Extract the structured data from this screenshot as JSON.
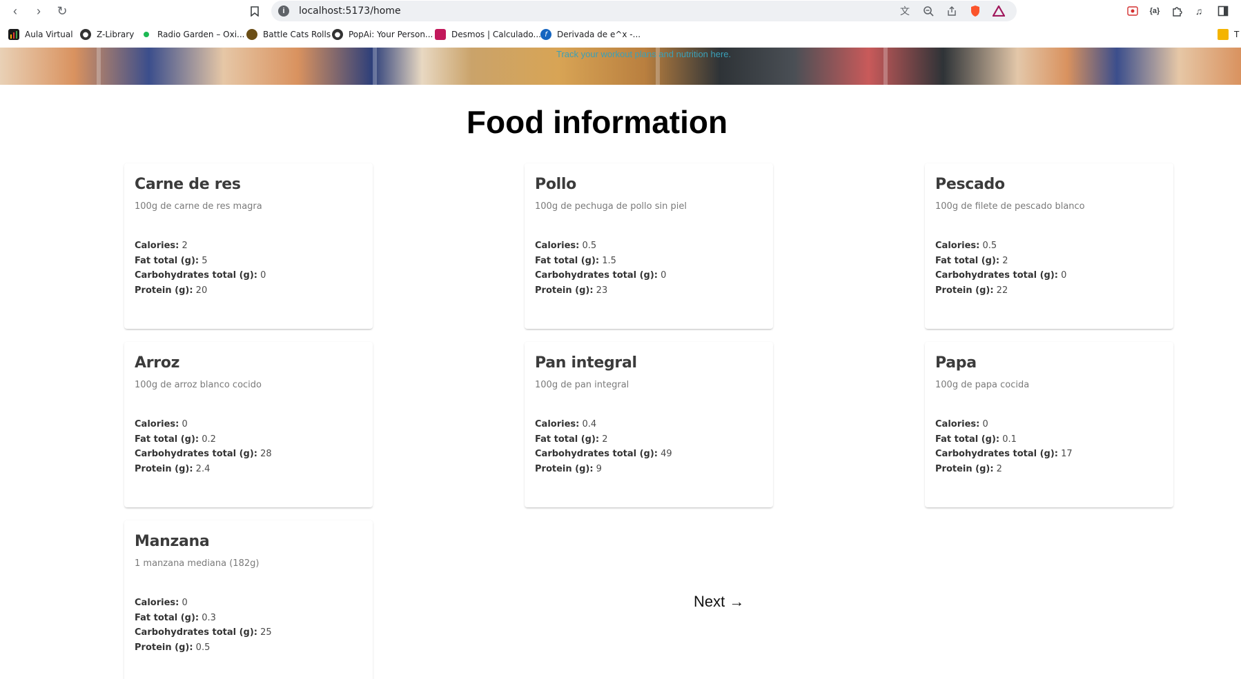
{
  "browser": {
    "url": "localhost:5173/home",
    "bookmarks": [
      {
        "label": "Aula Virtual",
        "icon": "bar-chart-icon",
        "color": "#2b2b2b"
      },
      {
        "label": "Z-Library",
        "icon": "globe-icon",
        "color": "#333333"
      },
      {
        "label": "Radio Garden – Oxi...",
        "icon": "green-dot-icon",
        "color": "#1db954"
      },
      {
        "label": "Battle Cats Rolls",
        "icon": "cat-icon",
        "color": "#6b4e16"
      },
      {
        "label": "PopAi: Your Person...",
        "icon": "globe-icon",
        "color": "#333333"
      },
      {
        "label": "Desmos | Calculado...",
        "icon": "desmos-icon",
        "color": "#c2185b"
      },
      {
        "label": "Derivada de e^x -...",
        "icon": "derivative-icon",
        "color": "#1565c0"
      }
    ],
    "folder_label": "T"
  },
  "hero": {
    "tagline": "Track your workout plans and nutrition here."
  },
  "page": {
    "title": "Food information",
    "next_label": "Next →"
  },
  "labels": {
    "calories": "Calories:",
    "fat": "Fat total (g):",
    "carbs": "Carbohydrates total (g):",
    "protein": "Protein (g):"
  },
  "foods": [
    {
      "name": "Carne de res",
      "portion": "100g de carne de res magra",
      "calories": "2",
      "fat": "5",
      "carbs": "0",
      "protein": "20"
    },
    {
      "name": "Pollo",
      "portion": "100g de pechuga de pollo sin piel",
      "calories": "0.5",
      "fat": "1.5",
      "carbs": "0",
      "protein": "23"
    },
    {
      "name": "Pescado",
      "portion": "100g de filete de pescado blanco",
      "calories": "0.5",
      "fat": "2",
      "carbs": "0",
      "protein": "22"
    },
    {
      "name": "Arroz",
      "portion": "100g de arroz blanco cocido",
      "calories": "0",
      "fat": "0.2",
      "carbs": "28",
      "protein": "2.4"
    },
    {
      "name": "Pan integral",
      "portion": "100g de pan integral",
      "calories": "0.4",
      "fat": "2",
      "carbs": "49",
      "protein": "9"
    },
    {
      "name": "Papa",
      "portion": "100g de papa cocida",
      "calories": "0",
      "fat": "0.1",
      "carbs": "17",
      "protein": "2"
    },
    {
      "name": "Manzana",
      "portion": "1 manzana mediana (182g)",
      "calories": "0",
      "fat": "0.3",
      "carbs": "25",
      "protein": "0.5"
    }
  ]
}
